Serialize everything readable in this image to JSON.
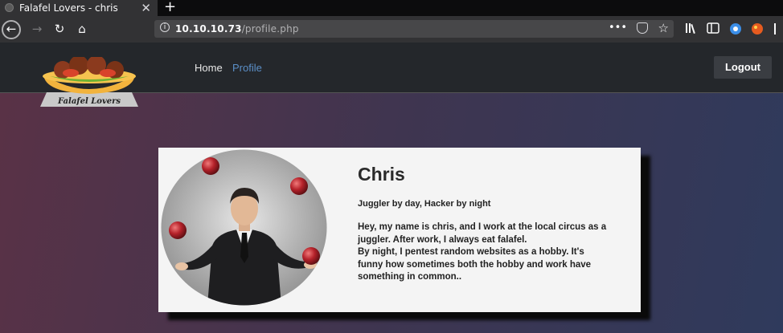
{
  "browser": {
    "tab_title": "Falafel Lovers - chris",
    "tab_close": "✕",
    "new_tab": "+",
    "url_host": "10.10.10.73",
    "url_path": "/profile.php",
    "url_more": "•••",
    "nav": {
      "back": "←",
      "forward": "→",
      "reload": "↻",
      "home": "⌂"
    }
  },
  "site": {
    "logo_text": "Falafel Lovers",
    "nav": {
      "home": "Home",
      "profile": "Profile"
    },
    "logout_label": "Logout"
  },
  "profile": {
    "name": "Chris",
    "tagline": "Juggler by day, Hacker by night",
    "bio_lines": [
      "Hey, my name is chris, and I work at the local circus as a",
      "juggler. After work, I always eat falafel.",
      "By night, I pentest random websites as a hobby. It's",
      "funny how sometimes both the hobby and work have",
      "something in common.."
    ]
  },
  "colors": {
    "nav_bg": "#24272b",
    "profile_link": "#5b8fc7",
    "card_bg": "#f4f4f4",
    "ball": "#b5222a"
  }
}
